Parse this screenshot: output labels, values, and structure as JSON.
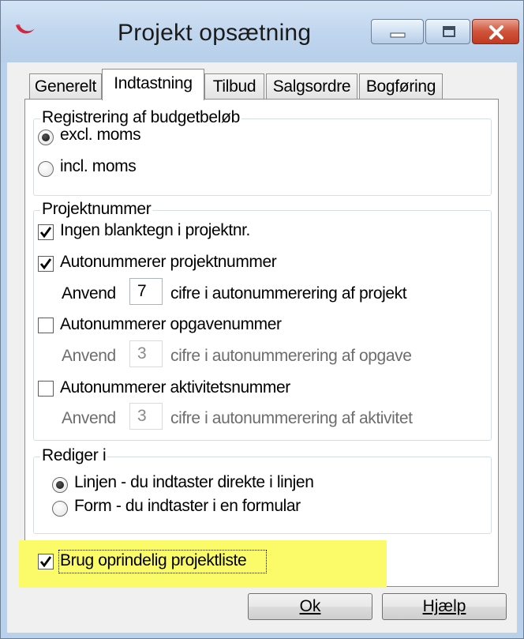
{
  "window": {
    "title": "Projekt opsætning"
  },
  "tabs": [
    {
      "label": "Generelt",
      "active": false
    },
    {
      "label": "Indtastning",
      "active": true
    },
    {
      "label": "Tilbud",
      "active": false
    },
    {
      "label": "Salgsordre",
      "active": false
    },
    {
      "label": "Bogføring",
      "active": false
    }
  ],
  "budget_group": {
    "title": "Registrering af budgetbeløb",
    "options": [
      {
        "label": "excl. moms",
        "selected": true
      },
      {
        "label": "incl. moms",
        "selected": false
      }
    ]
  },
  "projektnummer_group": {
    "title": "Projektnummer",
    "no_spaces": {
      "label": "Ingen blanktegn i projektnr.",
      "checked": true
    },
    "auto_project": {
      "label": "Autonummerer projektnummer",
      "checked": true
    },
    "auto_project_digits": {
      "prefix": "Anvend",
      "value": "7",
      "suffix": "cifre i autonummerering af projekt"
    },
    "auto_task": {
      "label": "Autonummerer opgavenummer",
      "checked": false
    },
    "auto_task_digits": {
      "prefix": "Anvend",
      "value": "3",
      "suffix": "cifre i autonummerering af opgave"
    },
    "auto_activity": {
      "label": "Autonummerer aktivitetsnummer",
      "checked": false
    },
    "auto_activity_digits": {
      "prefix": "Anvend",
      "value": "3",
      "suffix": "cifre i autonummerering af aktivitet"
    }
  },
  "edit_group": {
    "title": "Rediger i",
    "options": [
      {
        "label": "Linjen - du indtaster direkte i linjen",
        "selected": true
      },
      {
        "label": "Form - du indtaster i en formular",
        "selected": false
      }
    ]
  },
  "original_list": {
    "label": "Brug oprindelig projektliste",
    "checked": true
  },
  "buttons": {
    "ok": "Ok",
    "help": "Hjælp"
  },
  "colors": {
    "highlight": "#fbfb6a",
    "close_button": "#c9452d"
  }
}
